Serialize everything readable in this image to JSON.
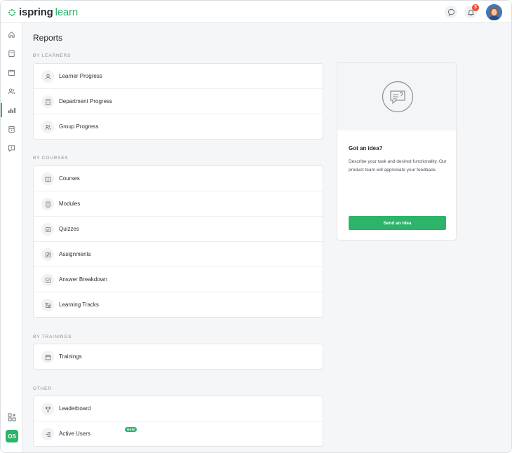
{
  "app": {
    "logo_text_a": "ispring",
    "logo_text_b": "learn",
    "notifications_count": "3",
    "accent_color": "#2db36a"
  },
  "sidebar": {
    "items": [
      {
        "icon": "home-icon"
      },
      {
        "icon": "book-icon"
      },
      {
        "icon": "calendar-icon"
      },
      {
        "icon": "users-icon"
      },
      {
        "icon": "reports-icon",
        "active": true
      },
      {
        "icon": "archive-icon"
      },
      {
        "icon": "feedback-icon"
      }
    ],
    "user_initials": "OS"
  },
  "page": {
    "title": "Reports"
  },
  "sections": {
    "by_learners": {
      "label": "BY LEARNERS",
      "rows": [
        {
          "label": "Learner Progress",
          "icon": "user-icon"
        },
        {
          "label": "Department Progress",
          "icon": "building-icon"
        },
        {
          "label": "Group Progress",
          "icon": "group-icon"
        }
      ]
    },
    "by_courses": {
      "label": "BY COURSES",
      "rows": [
        {
          "label": "Courses",
          "icon": "book-open-icon"
        },
        {
          "label": "Modules",
          "icon": "document-icon"
        },
        {
          "label": "Quizzes",
          "icon": "checkbox-icon"
        },
        {
          "label": "Assignments",
          "icon": "edit-icon"
        },
        {
          "label": "Answer Breakdown",
          "icon": "checkbox-icon"
        },
        {
          "label": "Learning Tracks",
          "icon": "route-icon"
        }
      ]
    },
    "by_trainings": {
      "label": "BY TRAININGS",
      "rows": [
        {
          "label": "Trainings",
          "icon": "calendar-icon"
        }
      ]
    },
    "other": {
      "label": "OTHER",
      "rows": [
        {
          "label": "Leaderboard",
          "icon": "trophy-icon"
        },
        {
          "label": "Active Users",
          "icon": "login-icon",
          "badge": "NEW"
        }
      ]
    }
  },
  "idea": {
    "title": "Got an idea?",
    "description": "Describe your task and desired functionality. Our product team will appreciate your feedback.",
    "button_label": "Send an Idea"
  }
}
